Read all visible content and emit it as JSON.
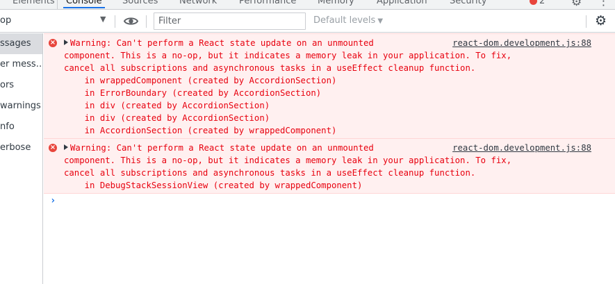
{
  "tabs": [
    {
      "label": "Elements",
      "active": false
    },
    {
      "label": "Console",
      "active": true
    },
    {
      "label": "Sources",
      "active": false
    },
    {
      "label": "Network",
      "active": false
    },
    {
      "label": "Performance",
      "active": false
    },
    {
      "label": "Memory",
      "active": false
    },
    {
      "label": "Application",
      "active": false
    },
    {
      "label": "Security",
      "active": false
    }
  ],
  "error_badge": "2",
  "toolbar": {
    "context": "op",
    "filter_placeholder": "Filter",
    "levels": "Default levels"
  },
  "sidebar": {
    "items": [
      {
        "label": "ssages",
        "selected": true
      },
      {
        "label": "er mess…",
        "selected": false
      },
      {
        "label": "ors",
        "selected": false
      },
      {
        "label": "warnings",
        "selected": false
      },
      {
        "label": "nfo",
        "selected": false
      },
      {
        "label": "erbose",
        "selected": false
      }
    ]
  },
  "messages": [
    {
      "source": "react-dom.development.js:88",
      "lines": [
        "Warning: Can't perform a React state update on an unmounted",
        "component. This is a no-op, but it indicates a memory leak in your application. To fix,",
        "cancel all subscriptions and asynchronous tasks in a useEffect cleanup function.",
        "    in wrappedComponent (created by AccordionSection)",
        "    in ErrorBoundary (created by AccordionSection)",
        "    in div (created by AccordionSection)",
        "    in div (created by AccordionSection)",
        "    in AccordionSection (created by wrappedComponent)"
      ]
    },
    {
      "source": "react-dom.development.js:88",
      "lines": [
        "Warning: Can't perform a React state update on an unmounted",
        "component. This is a no-op, but it indicates a memory leak in your application. To fix,",
        "cancel all subscriptions and asynchronous tasks in a useEffect cleanup function.",
        "    in DebugStackSessionView (created by wrappedComponent)"
      ]
    }
  ],
  "colors": {
    "error_text": "#e8000e",
    "error_bg": "#fff0f0",
    "accent": "#1a73e8"
  },
  "icons": {
    "eye": "eye-icon",
    "gear": "gear-icon",
    "error": "error-icon",
    "expand": "triangle-right-icon",
    "prompt": "chevron-right-icon"
  }
}
